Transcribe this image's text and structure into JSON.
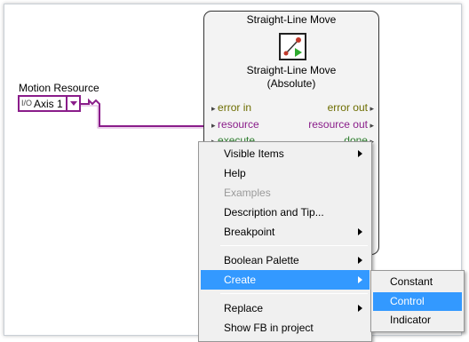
{
  "motion_resource": {
    "label": "Motion Resource",
    "type_icon": "I/O",
    "value": "Axis 1"
  },
  "function_block": {
    "title": "Straight-Line Move",
    "name_line1": "Straight-Line Move",
    "name_line2": "(Absolute)",
    "terminals": {
      "error_in": "error in",
      "error_out": "error out",
      "resource_in": "resource",
      "resource_out": "resource out",
      "execute": "execute",
      "done": "done"
    }
  },
  "context_menu": {
    "items": [
      {
        "label": "Visible Items",
        "submenu": true
      },
      {
        "label": "Help"
      },
      {
        "label": "Examples",
        "disabled": true
      },
      {
        "label": "Description and Tip..."
      },
      {
        "label": "Breakpoint",
        "submenu": true
      },
      {
        "label": "Boolean Palette",
        "submenu": true
      },
      {
        "label": "Create",
        "submenu": true,
        "selected": true
      },
      {
        "label": "Replace",
        "submenu": true
      },
      {
        "label": "Show FB in project"
      }
    ]
  },
  "create_submenu": {
    "items": [
      {
        "label": "Constant"
      },
      {
        "label": "Control",
        "selected": true
      },
      {
        "label": "Indicator"
      }
    ]
  },
  "colors": {
    "resource_wire": "#8a1d8a",
    "selection": "#3399ff",
    "menu_bg": "#f0f0f0"
  }
}
